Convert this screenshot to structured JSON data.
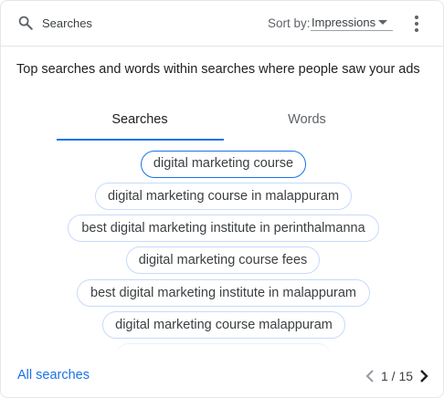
{
  "header": {
    "title": "Searches",
    "sort_label": "Sort by:",
    "sort_value": "Impressions"
  },
  "description": "Top searches and words within searches where people saw your ads",
  "tabs": [
    {
      "label": "Searches",
      "active": true
    },
    {
      "label": "Words",
      "active": false
    }
  ],
  "chips": [
    {
      "label": "digital marketing course",
      "selected": true
    },
    {
      "label": "digital marketing course in malappuram",
      "selected": false
    },
    {
      "label": "best digital marketing institute in perinthalmanna",
      "selected": false
    },
    {
      "label": "digital marketing course fees",
      "selected": false
    },
    {
      "label": "best digital marketing institute in malappuram",
      "selected": false
    },
    {
      "label": "digital marketing course malappuram",
      "selected": false
    },
    {
      "label": "",
      "selected": false
    }
  ],
  "footer": {
    "all_searches": "All searches",
    "pagination": "1 / 15"
  },
  "icons": {
    "search": "search-icon",
    "sort_caret": "caret-down-icon",
    "menu": "more-vert-icon",
    "prev": "chevron-left-icon",
    "next": "chevron-right-icon"
  },
  "colors": {
    "accent": "#1a73e8",
    "chip_border": "#c6dafc",
    "divider": "#e6e6e6"
  }
}
